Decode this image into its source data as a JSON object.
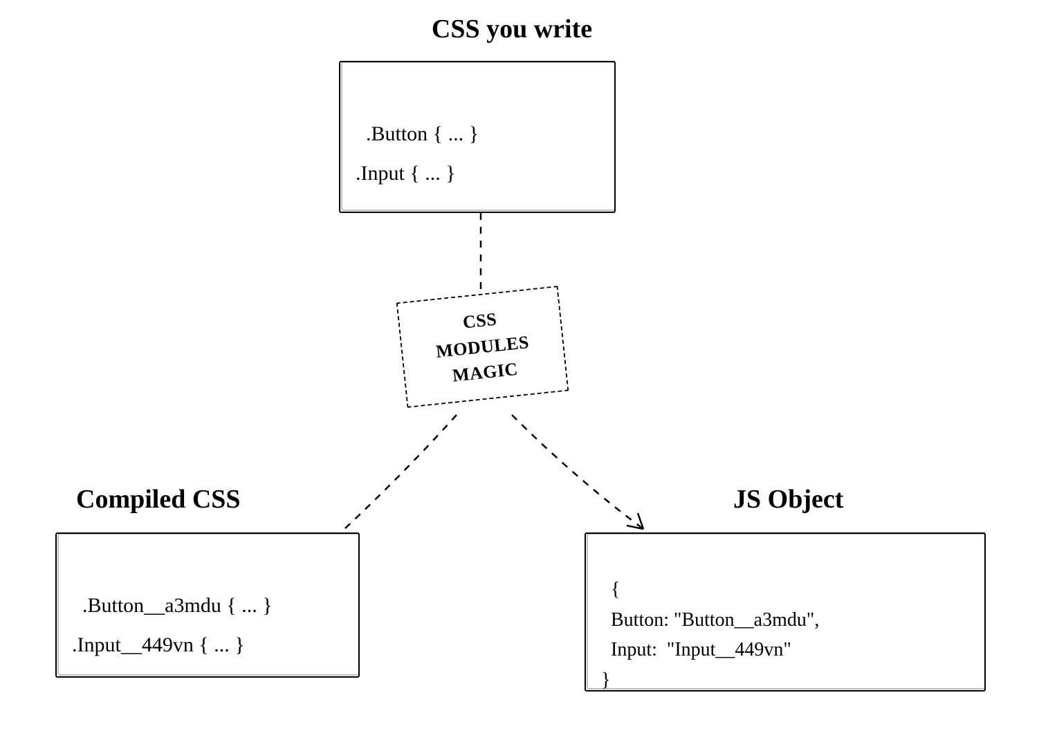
{
  "top": {
    "title": "CSS you write",
    "code": ".Button { ... }\n.Input { ... }"
  },
  "magic": {
    "line1": "CSS",
    "line2": "MODULES",
    "line3": "MAGIC"
  },
  "left": {
    "title": "Compiled CSS",
    "code": ".Button__a3mdu { ... }\n.Input__449vn { ... }"
  },
  "right": {
    "title": "JS Object",
    "code": "{\n  Button: \"Button__a3mdu\",\n  Input:  \"Input__449vn\"\n}"
  }
}
